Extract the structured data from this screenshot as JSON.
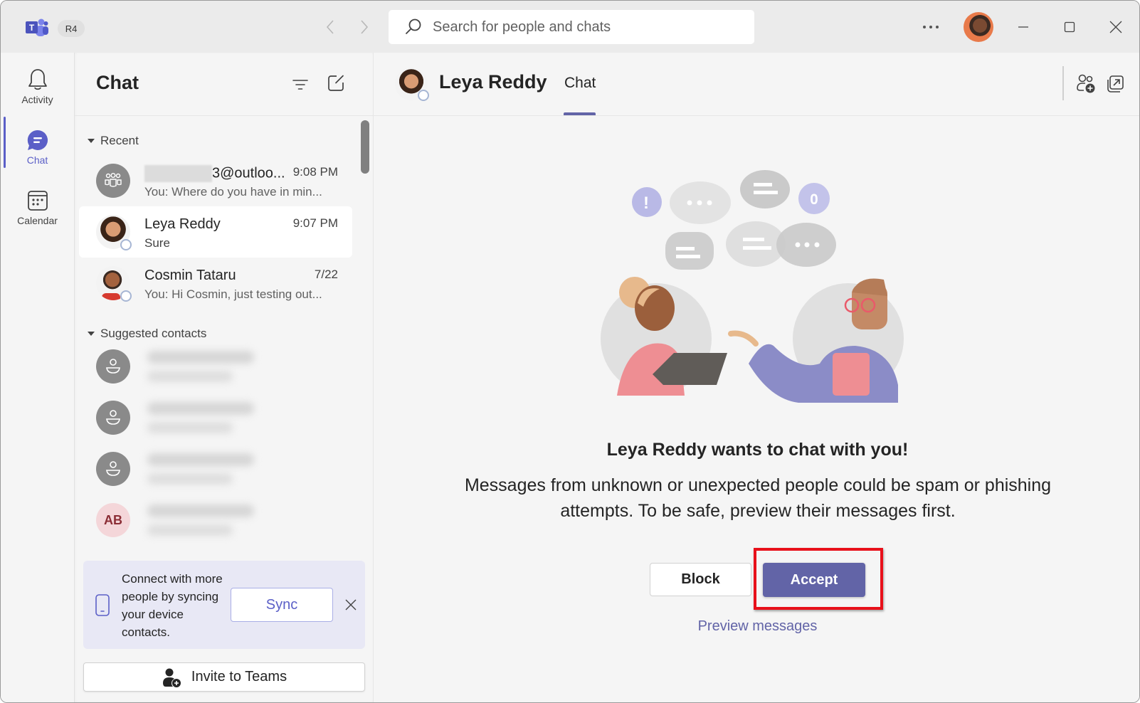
{
  "titlebar": {
    "ring_badge": "R4",
    "search_placeholder": "Search for people and chats",
    "more_label": "•••"
  },
  "rail": {
    "items": [
      {
        "label": "Activity",
        "icon": "bell-icon",
        "active": false
      },
      {
        "label": "Chat",
        "icon": "chat-icon",
        "active": true
      },
      {
        "label": "Calendar",
        "icon": "calendar-icon",
        "active": false
      }
    ]
  },
  "chat_list": {
    "title": "Chat",
    "sections": {
      "recent": "Recent",
      "suggested": "Suggested contacts"
    },
    "recent": [
      {
        "name_visible": "3@outloo...",
        "time": "9:08 PM",
        "preview": "You: Where do you have in min...",
        "avatar": "group-icon",
        "redacted_prefix": true
      },
      {
        "name": "Leya Reddy",
        "time": "9:07 PM",
        "preview": "Sure",
        "avatar": "photo",
        "selected": true
      },
      {
        "name": "Cosmin Tataru",
        "time": "7/22",
        "preview": "You: Hi Cosmin, just testing out...",
        "avatar": "photo"
      }
    ],
    "suggested": [
      {
        "avatar": "person-icon",
        "name": "",
        "blurred": true
      },
      {
        "avatar": "person-icon",
        "name": "",
        "blurred": true
      },
      {
        "avatar": "person-icon",
        "name": "",
        "blurred": true
      },
      {
        "avatar_initials": "AB",
        "name": "",
        "blurred": true
      }
    ],
    "sync_card": {
      "text": "Connect with more people by syncing your device contacts.",
      "button": "Sync"
    },
    "invite_button": "Invite to Teams"
  },
  "main": {
    "contact_name": "Leya Reddy",
    "tab": "Chat",
    "request_title": "Leya Reddy wants to chat with you!",
    "request_body": "Messages from unknown or unexpected people could be spam or phishing attempts. To be safe, preview their messages first.",
    "block_button": "Block",
    "accept_button": "Accept",
    "preview_link": "Preview messages"
  },
  "colors": {
    "brand": "#5b5fc7",
    "accent_button": "#6264a7",
    "highlight_annotation": "#e8101a"
  }
}
